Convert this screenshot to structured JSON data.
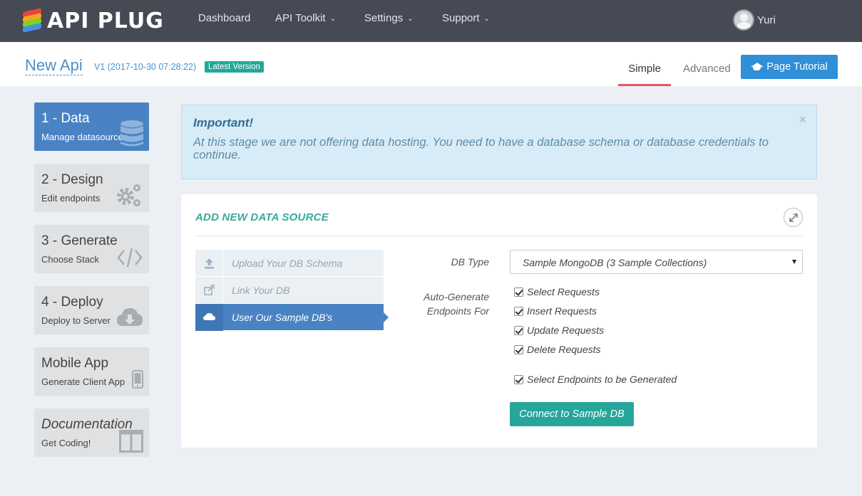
{
  "nav": {
    "logo_text": "API PLUG",
    "items": [
      {
        "label": "Dashboard",
        "has_caret": false
      },
      {
        "label": "API Toolkit",
        "has_caret": true
      },
      {
        "label": "Settings",
        "has_caret": true
      },
      {
        "label": "Support",
        "has_caret": true
      }
    ],
    "caret": "⌄",
    "user_name": "Yuri"
  },
  "header": {
    "api_name": "New Api",
    "version": "V1 (2017-10-30 07:28:22)",
    "badge": "Latest Version",
    "tabs": {
      "simple": "Simple",
      "advanced": "Advanced"
    },
    "tutorial_label": "Page Tutorial"
  },
  "sidebar": {
    "steps": [
      {
        "title": "1 - Data",
        "subtitle": "Manage datasources",
        "icon": "database-icon",
        "active": true
      },
      {
        "title": "2 - Design",
        "subtitle": "Edit endpoints",
        "icon": "gears-icon",
        "active": false
      },
      {
        "title": "3 - Generate",
        "subtitle": "Choose Stack",
        "icon": "code-icon",
        "active": false
      },
      {
        "title": "4 - Deploy",
        "subtitle": "Deploy to Server",
        "icon": "cloud-download-icon",
        "active": false
      },
      {
        "title": "Mobile App",
        "subtitle": "Generate Client App",
        "icon": "mobile-icon",
        "active": false
      },
      {
        "title": "Documentation",
        "subtitle": "Get Coding!",
        "icon": "book-icon",
        "active": false
      }
    ]
  },
  "alert": {
    "title": "Important!",
    "text": "At this stage we are not offering data hosting. You need to have a database schema or database credentials to continue.",
    "close": "×"
  },
  "panel": {
    "title": "ADD NEW DATA SOURCE",
    "sources": [
      {
        "label": "Upload Your DB Schema",
        "icon": "upload-icon",
        "active": false
      },
      {
        "label": "Link Your DB",
        "icon": "external-link-icon",
        "active": false
      },
      {
        "label": "User Our Sample DB's",
        "icon": "cloud-icon",
        "active": true
      }
    ],
    "db_type_label": "DB Type",
    "db_type_value": "Sample MongoDB (3 Sample Collections)",
    "autogen_label_1": "Auto-Generate",
    "autogen_label_2": "Endpoints For",
    "checks": [
      {
        "label": "Select Requests",
        "checked": true
      },
      {
        "label": "Insert Requests",
        "checked": true
      },
      {
        "label": "Update Requests",
        "checked": true
      },
      {
        "label": "Delete Requests",
        "checked": true
      }
    ],
    "select_endpoints": {
      "label": "Select Endpoints to be Generated",
      "checked": true
    },
    "connect_label": "Connect to Sample DB"
  },
  "colors": {
    "navbar": "#454a54",
    "primary": "#2f8fd8",
    "active_step": "#4a83c4",
    "teal": "#26a69a",
    "tab_underline": "#e0585f"
  }
}
